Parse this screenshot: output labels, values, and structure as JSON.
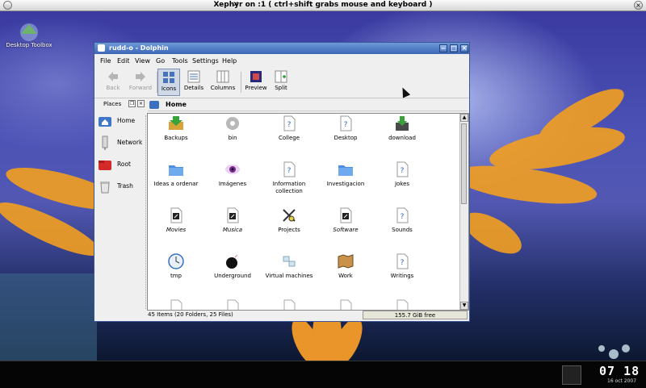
{
  "xephyr": {
    "title": "Xephyr on :1 ( ctrl+shift grabs mouse and keyboard )",
    "close": "×"
  },
  "desktop": {
    "toolbox_label": "Desktop Toolbox"
  },
  "window": {
    "title": "rudd-o - Dolphin",
    "menu": [
      "File",
      "Edit",
      "View",
      "Go",
      "Tools",
      "Settings",
      "Help"
    ],
    "toolbar": {
      "back": "Back",
      "forward": "Forward",
      "icons": "Icons",
      "details": "Details",
      "columns": "Columns",
      "preview": "Preview",
      "split": "Split"
    },
    "places": {
      "tab_label": "Places",
      "items": [
        "Home",
        "Network",
        "Root",
        "Trash"
      ]
    },
    "breadcrumb": "Home",
    "items": [
      {
        "name": "Backups",
        "icon": "folder-green-arrow-icon"
      },
      {
        "name": "bin",
        "icon": "gear-icon"
      },
      {
        "name": "College",
        "icon": "unknown-file-icon"
      },
      {
        "name": "Desktop",
        "icon": "unknown-file-icon"
      },
      {
        "name": "download",
        "icon": "download-icon"
      },
      {
        "name": "Ideas a ordenar",
        "icon": "folder-icon"
      },
      {
        "name": "Imágenes",
        "icon": "eye-icon"
      },
      {
        "name": "Information collection",
        "icon": "unknown-file-icon"
      },
      {
        "name": "Investigacion",
        "icon": "folder-icon"
      },
      {
        "name": "Jokes",
        "icon": "unknown-file-icon"
      },
      {
        "name": "Movies",
        "icon": "link-file-icon",
        "italic": true
      },
      {
        "name": "Musica",
        "icon": "link-file-icon",
        "italic": true
      },
      {
        "name": "Projects",
        "icon": "tools-icon"
      },
      {
        "name": "Software",
        "icon": "link-file-icon",
        "italic": true
      },
      {
        "name": "Sounds",
        "icon": "unknown-file-icon"
      },
      {
        "name": "tmp",
        "icon": "clock-icon"
      },
      {
        "name": "Underground",
        "icon": "bomb-icon"
      },
      {
        "name": "Virtual machines",
        "icon": "network-icon"
      },
      {
        "name": "Work",
        "icon": "map-icon"
      },
      {
        "name": "Writings",
        "icon": "unknown-file-icon"
      }
    ],
    "status": "45 Items (20 Folders, 25 Files)",
    "free_space": "155.7 GiB free"
  },
  "panel": {
    "time": "07 18",
    "date": "16 oct 2007"
  },
  "colors": {
    "accent": "#3b66b6",
    "title_bar": "#6e9ad8"
  }
}
